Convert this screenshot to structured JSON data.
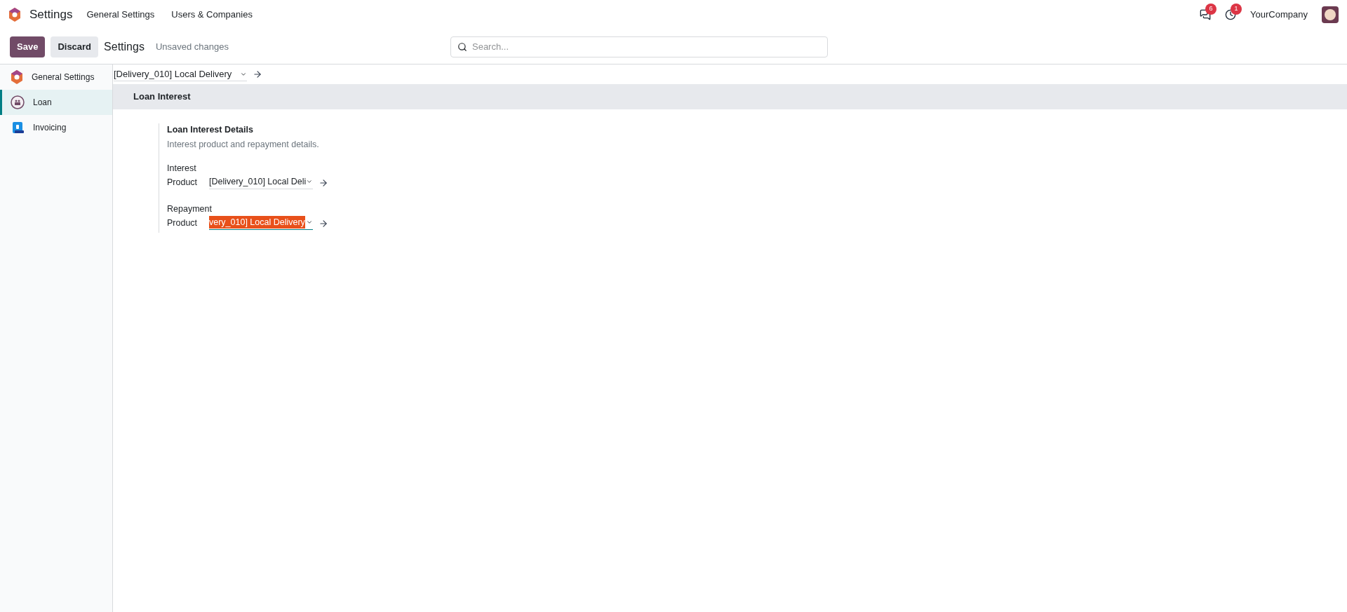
{
  "app": {
    "title": "Settings"
  },
  "top_menu": [
    {
      "label": "General Settings"
    },
    {
      "label": "Users & Companies"
    }
  ],
  "systray": {
    "messages_count": "6",
    "activities_count": "1",
    "company": "YourCompany"
  },
  "control_bar": {
    "save": "Save",
    "discard": "Discard",
    "breadcrumb": "Settings",
    "status": "Unsaved changes"
  },
  "search": {
    "placeholder": "Search..."
  },
  "sidebar": {
    "items": [
      {
        "label": "General Settings",
        "kind": "settings",
        "selected": false
      },
      {
        "label": "Loan",
        "kind": "loan",
        "selected": true
      },
      {
        "label": "Invoicing",
        "kind": "invoicing",
        "selected": false
      }
    ]
  },
  "top_field": {
    "value": "[Delivery_010] Local Delivery"
  },
  "section": {
    "title": "Loan Interest",
    "block": {
      "title": "Loan Interest Details",
      "description": "Interest product and repayment details.",
      "fields": [
        {
          "label_line1": "Interest",
          "label_line2": "Product",
          "value": "[Delivery_010] Local Deli",
          "focused": false,
          "text_selected": false
        },
        {
          "label_line1": "Repayment",
          "label_line2": "Product",
          "value": "very_010] Local Delivery",
          "focused": true,
          "text_selected": true
        }
      ]
    }
  }
}
